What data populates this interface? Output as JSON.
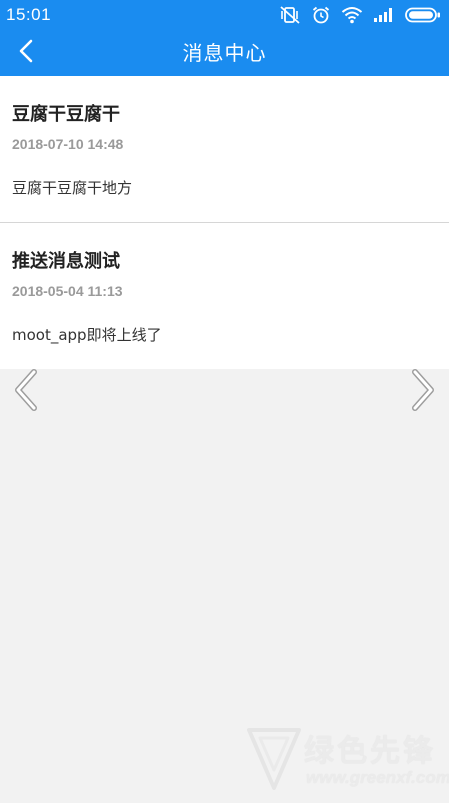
{
  "status_bar": {
    "time": "15:01",
    "icons": [
      "vibrate-off-icon",
      "alarm-icon",
      "wifi-icon",
      "signal-icon",
      "battery-icon"
    ]
  },
  "nav": {
    "title": "消息中心",
    "back_icon": "chevron-left-icon"
  },
  "messages": [
    {
      "title": "豆腐干豆腐干",
      "time": "2018-07-10 14:48",
      "body": "豆腐干豆腐干地方"
    },
    {
      "title": "推送消息测试",
      "time": "2018-05-04 11:13",
      "body": "moot_app即将上线了"
    }
  ],
  "pager": {
    "prev_icon": "chevron-left-icon",
    "next_icon": "chevron-right-icon"
  },
  "watermark": {
    "text": "绿色先锋",
    "url": "www.greenxf.com"
  },
  "colors": {
    "primary": "#1a8cf0",
    "background": "#f2f2f2",
    "card": "#ffffff",
    "title_text": "#222222",
    "time_text": "#9a9a9a",
    "divider": "#d6d6d6"
  }
}
